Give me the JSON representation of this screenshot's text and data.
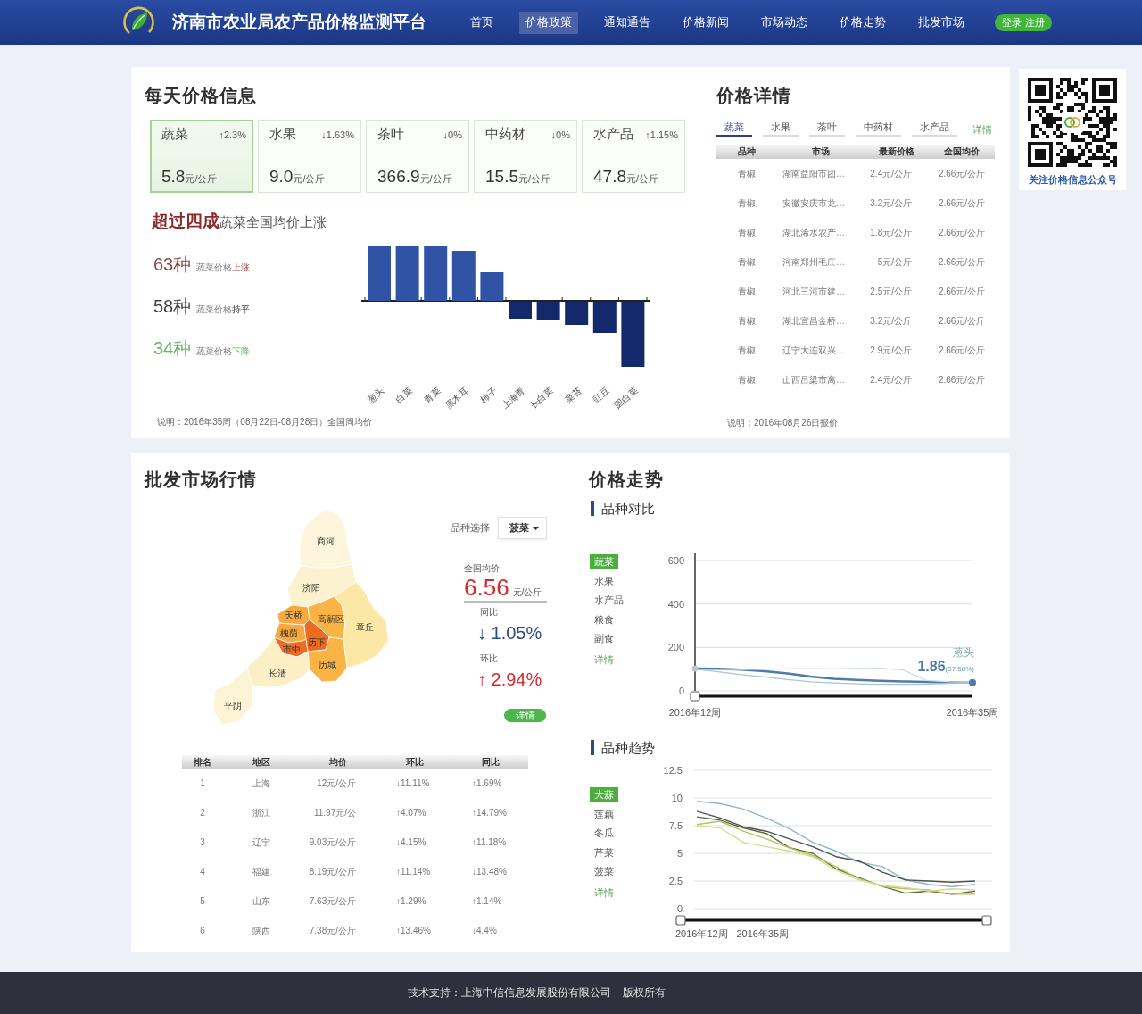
{
  "header": {
    "title": "济南市农业局农产品价格监测平台",
    "nav": [
      {
        "label": "首页",
        "selected": false
      },
      {
        "label": "价格政策",
        "selected": true
      },
      {
        "label": "通知通告",
        "selected": false
      },
      {
        "label": "价格新闻",
        "selected": false
      },
      {
        "label": "市场动态",
        "selected": false
      },
      {
        "label": "价格走势",
        "selected": false
      },
      {
        "label": "批发市场",
        "selected": false
      }
    ],
    "account_links": [
      "登录",
      "注册"
    ]
  },
  "daily_prices": {
    "title": "每天价格信息",
    "cards": [
      {
        "name": "蔬菜",
        "change": "↑2.3%",
        "value": "5.8",
        "unit": "元/公斤",
        "selected": true
      },
      {
        "name": "水果",
        "change": "↓1.63%",
        "value": "9.0",
        "unit": "元/公斤",
        "selected": false
      },
      {
        "name": "茶叶",
        "change": "↓0%",
        "value": "366.9",
        "unit": "元/公斤",
        "selected": false
      },
      {
        "name": "中药材",
        "change": "↓0%",
        "value": "15.5",
        "unit": "元/公斤",
        "selected": false
      },
      {
        "name": "水产品",
        "change": "↑1.15%",
        "value": "47.8",
        "unit": "元/公斤",
        "selected": false
      }
    ],
    "headline": "**超过四成**蔬菜全国均价上涨",
    "stats": [
      {
        "count": "63种",
        "label": "蔬菜价格",
        "trend": "上涨",
        "color": "#8a4a48"
      },
      {
        "count": "58种",
        "label": "蔬菜价格",
        "trend": "持平",
        "color": "#444444"
      },
      {
        "count": "34种",
        "label": "蔬菜价格",
        "trend": "下降",
        "color": "#5cb85c"
      }
    ],
    "bar_chart": {
      "labels": [
        "葱头",
        "白菜",
        "青菜",
        "黑木耳",
        "柿子",
        "上海青",
        "长白菜",
        "菜苔",
        "豇豆",
        "圆白菜"
      ]
    },
    "note": "说明：2016年35周（08月22日-08月28日）全国周均价"
  },
  "price_details": {
    "title": "价格详情",
    "tabs": [
      {
        "label": "蔬菜",
        "selected": true
      },
      {
        "label": "水果",
        "selected": false
      },
      {
        "label": "茶叶",
        "selected": false
      },
      {
        "label": "中药材",
        "selected": false
      },
      {
        "label": "水产品",
        "selected": false
      }
    ],
    "more_link": "详情",
    "columns": [
      "品种",
      "市场",
      "最新价格",
      "全国均价"
    ],
    "rows": [
      [
        "青椒",
        "湖南益阳市团…",
        "2.4元/公斤",
        "2.66元/公斤"
      ],
      [
        "青椒",
        "安徽安庆市龙…",
        "3.2元/公斤",
        "2.66元/公斤"
      ],
      [
        "青椒",
        "湖北浠水农产…",
        "1.8元/公斤",
        "2.66元/公斤"
      ],
      [
        "青椒",
        "河南郑州毛庄…",
        "5元/公斤",
        "2.66元/公斤"
      ],
      [
        "青椒",
        "河北三河市建…",
        "2.5元/公斤",
        "2.66元/公斤"
      ],
      [
        "青椒",
        "湖北宜昌金桥…",
        "3.2元/公斤",
        "2.66元/公斤"
      ],
      [
        "青椒",
        "辽宁大连双兴…",
        "2.9元/公斤",
        "2.66元/公斤"
      ],
      [
        "青椒",
        "山西吕梁市离…",
        "2.4元/公斤",
        "2.66元/公斤"
      ]
    ],
    "note": "说明：2016年08月26日报价"
  },
  "qr_card": {
    "caption": "关注价格信息公众号"
  },
  "wholesale": {
    "title": "批发市场行情",
    "map": {
      "regions": [
        {
          "name": "商河",
          "color": "#fdf6dc"
        },
        {
          "name": "济阳",
          "color": "#fdf2cf"
        },
        {
          "name": "天桥",
          "color": "#f8a93e"
        },
        {
          "name": "槐荫",
          "color": "#f8a93e"
        },
        {
          "name": "市中",
          "color": "#ee6a1e"
        },
        {
          "name": "历下",
          "color": "#ee6a1e"
        },
        {
          "name": "高新区",
          "color": "#fab445"
        },
        {
          "name": "历城",
          "color": "#fab445"
        },
        {
          "name": "章丘",
          "color": "#fce8a6"
        },
        {
          "name": "长清",
          "color": "#fcefc6"
        },
        {
          "name": "平阴",
          "color": "#fdf4d6"
        }
      ]
    },
    "variety_label": "品种选择",
    "variety_select": {
      "value": "菠菜"
    },
    "average": {
      "label": "全国均价",
      "value": "6.56",
      "unit": "元/公斤"
    },
    "changes": [
      {
        "label": "同比",
        "value": "↓ 1.05%",
        "kind": "down"
      },
      {
        "label": "环比",
        "value": "↑ 2.94%",
        "kind": "up"
      }
    ],
    "detail_button": "详情",
    "table": {
      "columns": [
        "排名",
        "地区",
        "均价",
        "环比",
        "同比"
      ],
      "rows": [
        [
          "1",
          "上海",
          "12元/公斤",
          "↓11.11%",
          "↑1.69%"
        ],
        [
          "2",
          "浙江",
          "11.97元/公",
          "↑4.07%",
          "↑14.79%"
        ],
        [
          "3",
          "辽宁",
          "9.03元/公斤",
          "↓4.15%",
          "↑11.18%"
        ],
        [
          "4",
          "福建",
          "8.19元/公斤",
          "↑11.14%",
          "↓13.48%"
        ],
        [
          "5",
          "山东",
          "7.63元/公斤",
          "↑1.29%",
          "↑1.14%"
        ],
        [
          "6",
          "陕西",
          "7.38元/公斤",
          "↑13.46%",
          "↓4.4%"
        ]
      ]
    }
  },
  "price_trend": {
    "title": "价格走势",
    "comparison": {
      "title": "品种对比",
      "options": [
        {
          "label": "蔬菜",
          "selected": true
        },
        {
          "label": "水果",
          "selected": false
        },
        {
          "label": "水产品",
          "selected": false
        },
        {
          "label": "粮食",
          "selected": false
        },
        {
          "label": "副食",
          "selected": false
        }
      ],
      "more_link": "详情",
      "zoom_bar": {
        "start_handle": true,
        "end_handle": false
      },
      "chart_data": {
        "type": "line",
        "categories": [
          "2016年12周",
          null,
          null,
          null,
          null,
          null,
          null,
          null,
          null,
          null,
          null,
          null,
          "2016年35周"
        ],
        "ylim": [
          0,
          600
        ],
        "yticks": [
          0,
          200,
          400,
          600
        ],
        "grid": true,
        "series": [
          {
            "name": "葱头",
            "color": "#4e7ca8",
            "values": [
              103,
              102,
              98,
              90,
              80,
              66,
              56,
              50,
              46,
              43,
              41,
              39,
              38
            ]
          },
          {
            "color": "#cdd9e3",
            "values": [
              100,
              100,
              98,
              99,
              101,
              102,
              101,
              103,
              104,
              96,
              48,
              42,
              40
            ]
          },
          {
            "color": "#a8c2d6",
            "values": [
              100,
              88,
              75,
              64,
              52,
              42,
              36,
              32,
              30,
              30,
              31,
              34,
              36
            ]
          }
        ],
        "annotations": [
          {
            "text": "**1.86**(37.58%)"
          }
        ]
      }
    },
    "trend": {
      "title": "品种趋势",
      "options": [
        {
          "label": "大蒜",
          "selected": true
        },
        {
          "label": "莲藕",
          "selected": false
        },
        {
          "label": "冬瓜",
          "selected": false
        },
        {
          "label": "芹菜",
          "selected": false
        },
        {
          "label": "菠菜",
          "selected": false
        }
      ],
      "more_link": "详情",
      "zoom_bar": {
        "start_handle": true,
        "end_handle": true
      },
      "zoom_label": "2016年12周 - 2016年35周",
      "chart_data": {
        "type": "line",
        "categories": [
          null,
          null,
          null,
          null,
          null,
          null,
          null,
          null,
          null,
          null,
          null,
          null,
          null
        ],
        "ylim": [
          0,
          12.5
        ],
        "yticks": [
          0,
          2.5,
          5,
          7.5,
          10,
          12.5
        ],
        "grid": true,
        "series": [
          {
            "color": "#8cb8c6",
            "values": [
              9.7,
              9.5,
              9.0,
              8.2,
              7.2,
              6.0,
              5.2,
              4.2,
              3.8,
              2.6,
              2.2,
              2.0,
              2.2
            ]
          },
          {
            "color": "#4a5252",
            "values": [
              8.8,
              8.2,
              7.4,
              7.0,
              6.3,
              5.6,
              4.7,
              4.3,
              3.3,
              2.6,
              2.5,
              2.4,
              2.5
            ]
          },
          {
            "color": "#5f6e3d",
            "values": [
              8.3,
              8.0,
              7.3,
              6.8,
              5.5,
              5.0,
              3.6,
              2.8,
              2.0,
              1.4,
              1.6,
              1.3,
              1.6
            ]
          },
          {
            "color": "#b5c25a",
            "values": [
              7.6,
              7.9,
              7.0,
              6.3,
              5.5,
              4.8,
              3.8,
              2.7,
              2.0,
              1.8,
              1.7,
              1.3,
              1.3
            ]
          },
          {
            "color": "#d8da8e",
            "values": [
              7.5,
              7.3,
              6.0,
              5.6,
              5.2,
              4.7,
              3.5,
              2.6,
              2.1,
              1.9,
              1.6,
              1.8,
              1.7
            ]
          }
        ]
      }
    }
  },
  "footer": {
    "support": "技术支持：上海中信信息发展股份有限公司",
    "rights": "版权所有"
  }
}
